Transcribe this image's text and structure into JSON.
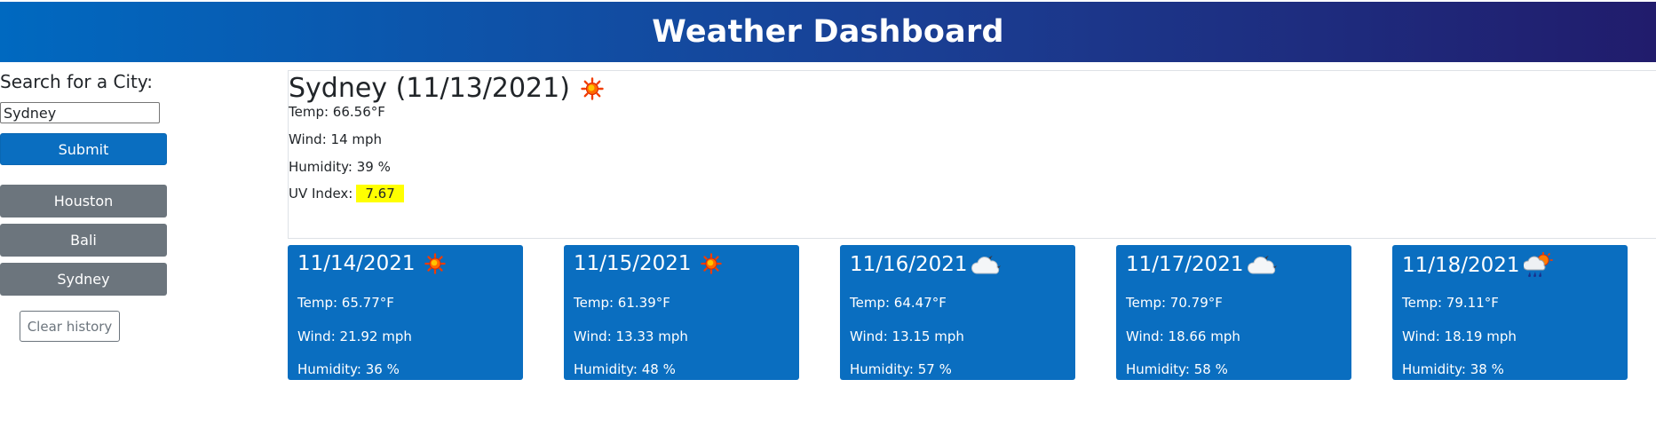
{
  "header": {
    "title": "Weather Dashboard"
  },
  "sidebar": {
    "search_label": "Search for a City:",
    "search_value": "Sydney",
    "submit_label": "Submit",
    "history": [
      {
        "label": "Houston"
      },
      {
        "label": "Bali"
      },
      {
        "label": "Sydney"
      }
    ],
    "clear_label": "Clear history"
  },
  "current": {
    "title": "Sydney (11/13/2021)",
    "icon": "sun-icon",
    "temp": "Temp: 66.56°F",
    "wind": "Wind: 14 mph",
    "humidity": "Humidity: 39 %",
    "uv_label": "UV Index:",
    "uv_value": "7.67",
    "uv_color": "#ffff00"
  },
  "forecast": [
    {
      "date": "11/14/2021",
      "icon": "sun-icon",
      "temp": "Temp: 65.77°F",
      "wind": "Wind: 21.92 mph",
      "humidity": "Humidity: 36 %"
    },
    {
      "date": "11/15/2021",
      "icon": "sun-icon",
      "temp": "Temp: 61.39°F",
      "wind": "Wind: 13.33 mph",
      "humidity": "Humidity: 48 %"
    },
    {
      "date": "11/16/2021",
      "icon": "cloud-moon-icon",
      "temp": "Temp: 64.47°F",
      "wind": "Wind: 13.15 mph",
      "humidity": "Humidity: 57 %"
    },
    {
      "date": "11/17/2021",
      "icon": "cloud-moon-icon",
      "temp": "Temp: 70.79°F",
      "wind": "Wind: 18.66 mph",
      "humidity": "Humidity: 58 %"
    },
    {
      "date": "11/18/2021",
      "icon": "rain-sun-icon",
      "temp": "Temp: 79.11°F",
      "wind": "Wind: 18.19 mph",
      "humidity": "Humidity: 38 %"
    }
  ],
  "colors": {
    "primary": "#0a6ec0",
    "secondary": "#6c757d",
    "header_start": "#0069c0",
    "header_end": "#211c6c"
  }
}
